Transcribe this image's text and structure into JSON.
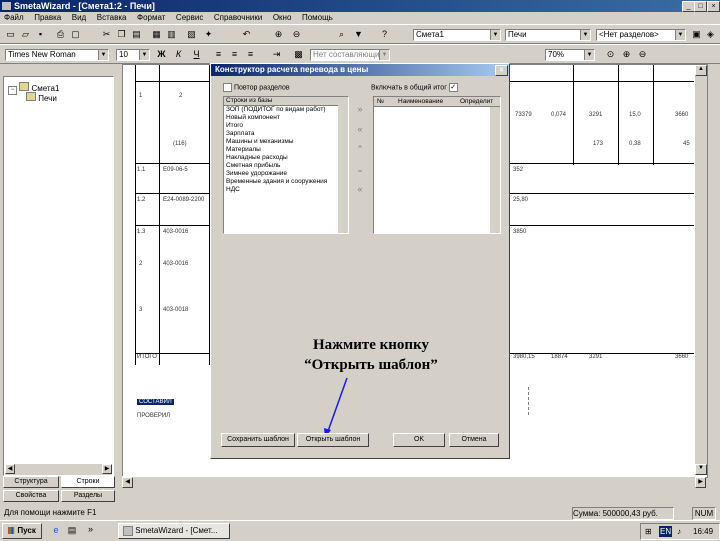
{
  "window": {
    "title": "SmetaWizard - [Смета1:2 - Печи]"
  },
  "menu": [
    "Файл",
    "Правка",
    "Вид",
    "Вставка",
    "Формат",
    "Сервис",
    "Справочники",
    "Окно",
    "Помощь"
  ],
  "toolbar2": {
    "smeta_combo": "Смета1",
    "section_combo": "Печи",
    "subsection_combo": "<Нет разделов>"
  },
  "toolbar3": {
    "font": "Times New Roman",
    "size": "10",
    "style_combo": "Нет составляющих",
    "zoom": "70%"
  },
  "tree": {
    "root": "Смета1",
    "child": "Печи"
  },
  "left_tabs": [
    "Структура",
    "Строки",
    "Свойства",
    "Разделы"
  ],
  "doc_rows": [
    {
      "num": "1",
      "code": "2",
      "c3": "",
      "v1": "73379",
      "v2": "0,074",
      "v3": "3291",
      "v4": "15,0",
      "v5": "3660"
    },
    {
      "num": "",
      "code": "(116)",
      "c3": "",
      "v1": "",
      "v2": "",
      "v3": "173",
      "v4": "0,38",
      "v5": "45"
    },
    {
      "num": "1.1",
      "code": "Е09-06-5",
      "c3": "",
      "v1": "352",
      "v2": "",
      "v3": "",
      "v4": "",
      "v5": ""
    },
    {
      "num": "1.2",
      "code": "Е24-0089-2200",
      "c3": "",
      "v1": "25,80",
      "v2": "",
      "v3": "",
      "v4": "",
      "v5": ""
    },
    {
      "num": "1.3",
      "code": "403-0016",
      "c3": "",
      "v1": "3850",
      "v2": "",
      "v3": "",
      "v4": "",
      "v5": ""
    },
    {
      "num": "2",
      "code": "403-0016",
      "c3": "",
      "v1": "",
      "v2": "",
      "v3": "",
      "v4": "",
      "v5": ""
    },
    {
      "num": "3",
      "code": "403-0018",
      "c3": "",
      "v1": "",
      "v2": "",
      "v3": "",
      "v4": "",
      "v5": ""
    }
  ],
  "doc_total": {
    "label": "ИТОГО",
    "v1": "3980,15",
    "v2": "18874",
    "v3": "3291",
    "v4": "",
    "v5": "3660"
  },
  "doc_highlight": "СОСТАВИЛ",
  "doc_checked": "ПРОВЕРИЛ",
  "dialog": {
    "title": "Конструктор расчета перевода в цены",
    "repeat_label": "Повтор разделов",
    "include_label": "Включать в общий итог",
    "left_header": "Строки из базы",
    "right_headers": [
      "№",
      "Наименование",
      "Определит"
    ],
    "items": [
      "ЗОП (ПОДИТОГ по видам работ)",
      "Новый компонент",
      "Итого",
      "Зарплата",
      "Машины и механизмы",
      "Материалы",
      "Накладные расходы",
      "Сметная прибыль",
      "Зимнее удорожание",
      "Временные здания и сооружения",
      "НДС"
    ],
    "btn_save": "Сохранить шаблон",
    "btn_open": "Открыть шаблон",
    "btn_ok": "OK",
    "btn_cancel": "Отмена"
  },
  "callout": {
    "line1": "Нажмите кнопку",
    "line2": "“Открыть шаблон”",
    "color": "#1a1ae6"
  },
  "status": {
    "left": "Для помощи нажмите F1",
    "sum": "Сумма: 500000,43 руб.",
    "num": "NUM"
  },
  "taskbar": {
    "start": "Пуск",
    "app": "SmetaWizard - [Смет...",
    "lang": "EN",
    "time": "16:49"
  }
}
